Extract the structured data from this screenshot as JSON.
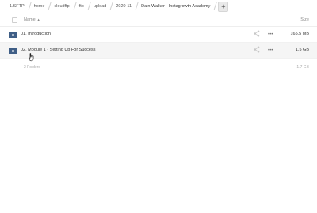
{
  "breadcrumb": {
    "items": [
      "1.SFTP",
      "home",
      "cloudftp",
      "ftp",
      "upload",
      "2020-11",
      "Dain Walker - Instagrowth Academy"
    ],
    "add_label": "+"
  },
  "header": {
    "name_label": "Name",
    "sort_indicator": "▲",
    "size_label": "Size"
  },
  "files": [
    {
      "name": "01. Introduction",
      "size": "165.5 MB",
      "icon": "folder-icon"
    },
    {
      "name": "02. Module 1 - Setting Up For Success",
      "size": "1.5 GB",
      "icon": "folder-icon"
    }
  ],
  "summary": {
    "count": "2 Folders",
    "total": "1.7 GB"
  },
  "colors": {
    "folder": "#3f5e86",
    "row_hover": "#f5f5f5"
  }
}
